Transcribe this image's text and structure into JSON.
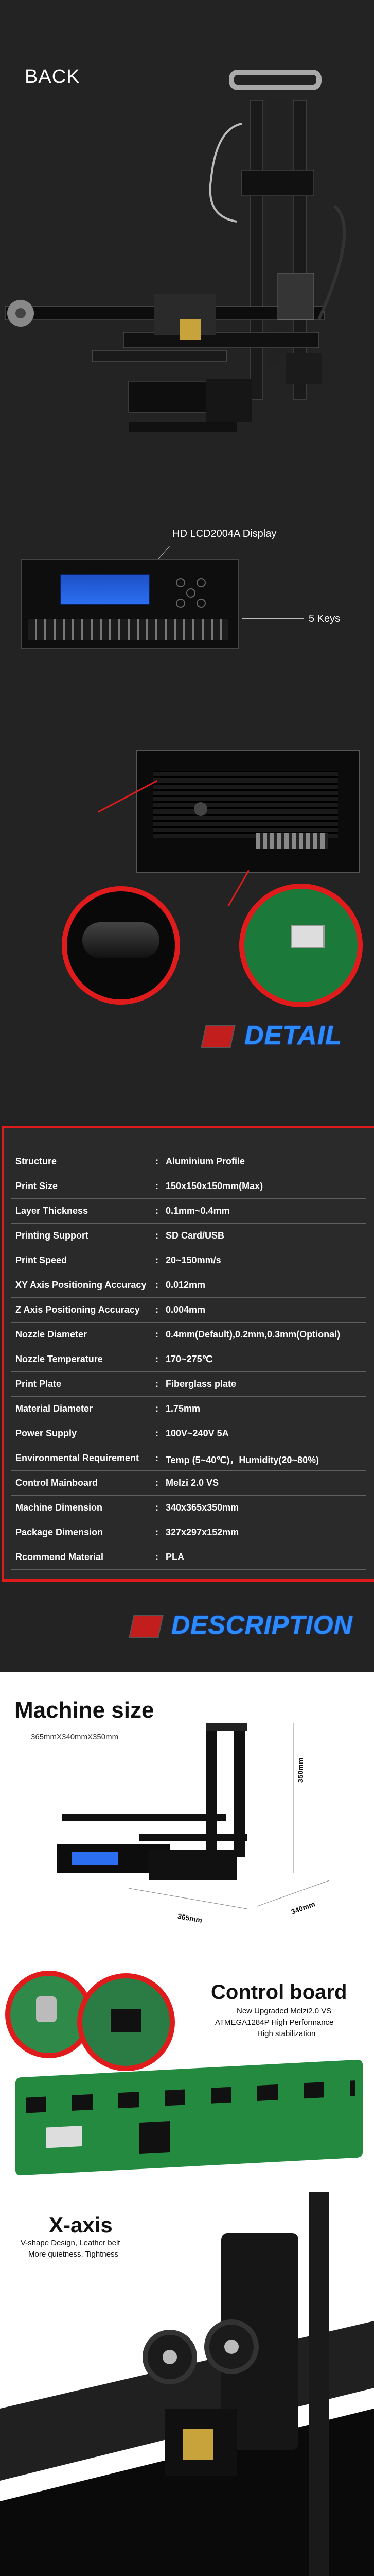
{
  "back": {
    "title": "BACK"
  },
  "lcd": {
    "display_label": "HD LCD2004A Display",
    "keys_label": "5 Keys"
  },
  "banners": {
    "detail": "DETAIL",
    "description": "DESCRIPTION"
  },
  "specs": [
    {
      "key": "Structure",
      "value": "Aluminium Profile"
    },
    {
      "key": "Print Size",
      "value": "150x150x150mm(Max)"
    },
    {
      "key": "Layer Thickness",
      "value": "0.1mm~0.4mm"
    },
    {
      "key": "Printing Support",
      "value": "SD Card/USB"
    },
    {
      "key": "Print Speed",
      "value": "20~150mm/s"
    },
    {
      "key": "XY Axis Positioning Accuracy",
      "value": "0.012mm"
    },
    {
      "key": "Z Axis Positioning Accuracy",
      "value": "0.004mm"
    },
    {
      "key": "Nozzle Diameter",
      "value": "0.4mm(Default),0.2mm,0.3mm(Optional)"
    },
    {
      "key": "Nozzle Temperature",
      "value": "170~275℃"
    },
    {
      "key": "Print Plate",
      "value": "Fiberglass plate"
    },
    {
      "key": "Material Diameter",
      "value": "1.75mm"
    },
    {
      "key": "Power Supply",
      "value": "100V~240V   5A"
    },
    {
      "key": "Environmental Requirement",
      "value": "Temp (5~40℃)，Humidity(20~80%)"
    },
    {
      "key": "Control Mainboard",
      "value": "Melzi  2.0  VS"
    },
    {
      "key": "Machine Dimension",
      "value": "340x365x350mm"
    },
    {
      "key": "Package Dimension",
      "value": "327x297x152mm"
    },
    {
      "key": "Rcommend Material",
      "value": "PLA"
    }
  ],
  "spec_separator": ":",
  "machine_size": {
    "title": "Machine size",
    "subtitle": "365mmX340mmX350mm",
    "dim_height": "350mm",
    "dim_width": "365mm",
    "dim_depth": "340mm"
  },
  "control_board": {
    "title": "Control board",
    "line1": "New Upgraded Melzi2.0 VS",
    "line2": "ATMEGA1284P  High Performance",
    "line3": "High stabilization"
  },
  "x_axis": {
    "title": "X-axis",
    "line1": "V-shape Design, Leather belt",
    "line2": "More quietness, Tightness"
  }
}
